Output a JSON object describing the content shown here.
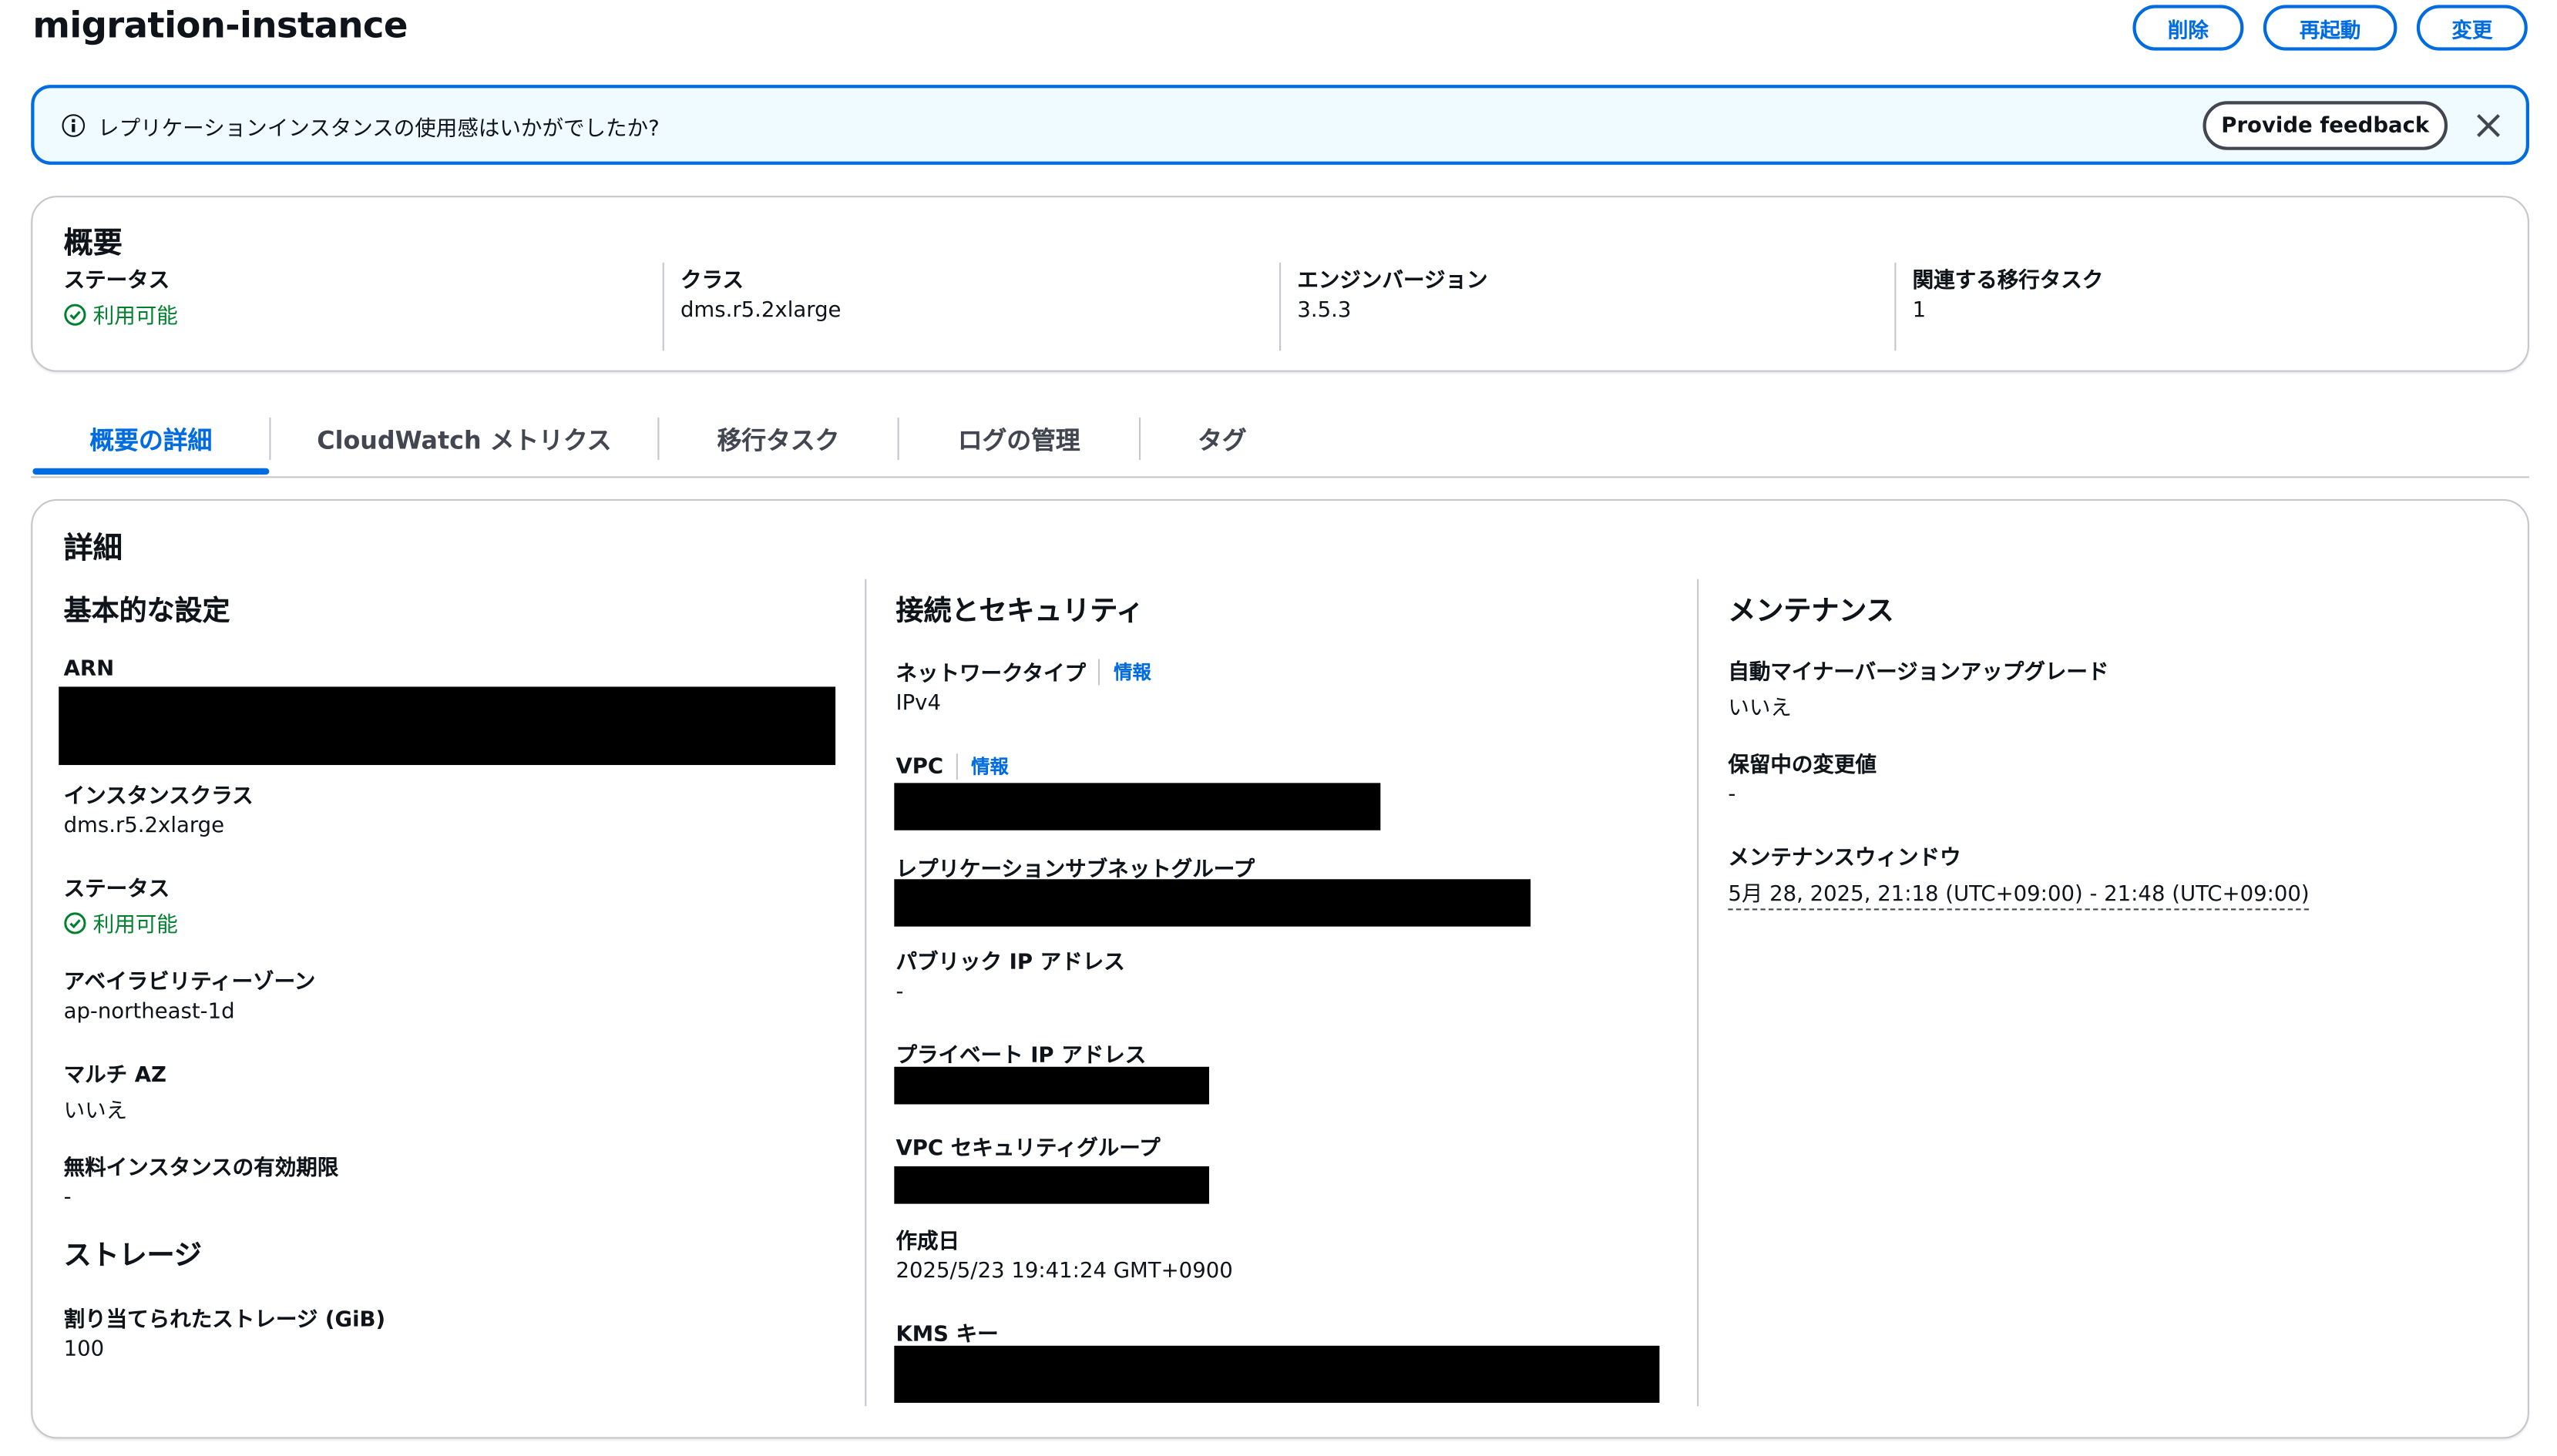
{
  "page": {
    "title": "migration-instance",
    "actions": {
      "delete": "削除",
      "restart": "再起動",
      "modify": "変更"
    }
  },
  "banner": {
    "message": "レプリケーションインスタンスの使用感はいかがでしたか?",
    "feedback_button": "Provide feedback"
  },
  "summary": {
    "heading": "概要",
    "status_label": "ステータス",
    "status_value": "利用可能",
    "class_label": "クラス",
    "class_value": "dms.r5.2xlarge",
    "engine_label": "エンジンバージョン",
    "engine_value": "3.5.3",
    "tasks_label": "関連する移行タスク",
    "tasks_value": "1"
  },
  "tabs": [
    "概要の詳細",
    "CloudWatch メトリクス",
    "移行タスク",
    "ログの管理",
    "タグ"
  ],
  "details": {
    "heading": "詳細",
    "basic": {
      "heading": "基本的な設定",
      "arn_label": "ARN",
      "class_label": "インスタンスクラス",
      "class_value": "dms.r5.2xlarge",
      "status_label": "ステータス",
      "status_value": "利用可能",
      "az_label": "アベイラビリティーゾーン",
      "az_value": "ap-northeast-1d",
      "multiaz_label": "マルチ AZ",
      "multiaz_value": "いいえ",
      "free_label": "無料インスタンスの有効期限",
      "free_value": "-"
    },
    "storage": {
      "heading": "ストレージ",
      "alloc_label": "割り当てられたストレージ (GiB)",
      "alloc_value": "100"
    },
    "network": {
      "heading": "接続とセキュリティ",
      "nettype_label": "ネットワークタイプ",
      "info": "情報",
      "nettype_value": "IPv4",
      "vpc_label": "VPC",
      "subnet_label": "レプリケーションサブネットグループ",
      "public_ip_label": "パブリック IP アドレス",
      "public_ip_value": "-",
      "private_ip_label": "プライベート IP アドレス",
      "sg_label": "VPC セキュリティグループ",
      "created_label": "作成日",
      "created_value": "2025/5/23 19:41:24 GMT+0900",
      "kms_label": "KMS キー"
    },
    "maintenance": {
      "heading": "メンテナンス",
      "auto_label": "自動マイナーバージョンアップグレード",
      "auto_value": "いいえ",
      "pending_label": "保留中の変更値",
      "pending_value": "-",
      "window_label": "メンテナンスウィンドウ",
      "window_value": "5月 28, 2025, 21:18 (UTC+09:00) - 21:48 (UTC+09:00)"
    }
  }
}
